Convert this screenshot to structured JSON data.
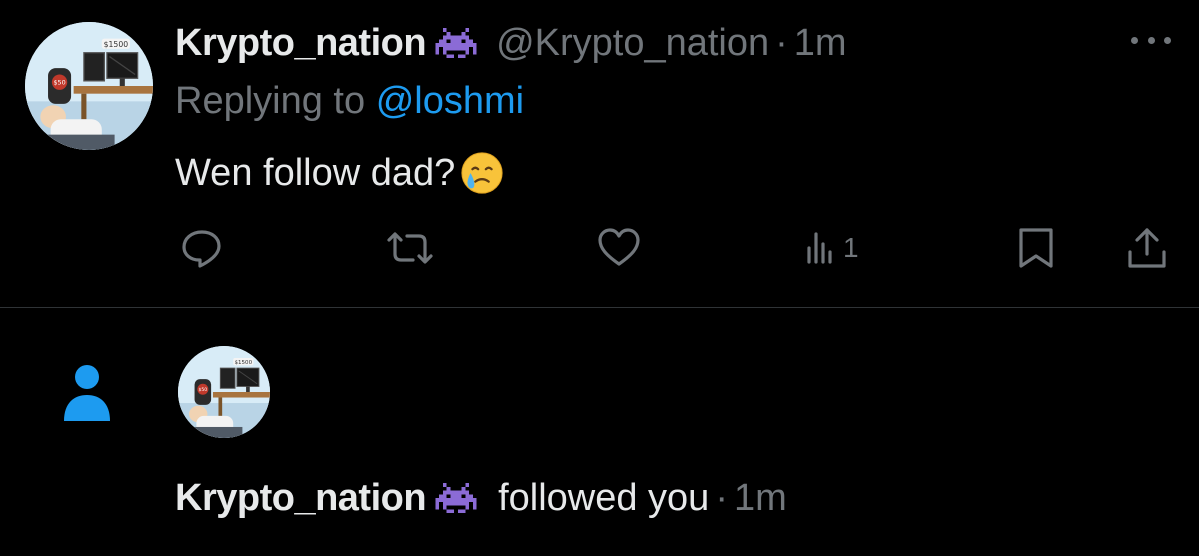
{
  "tweet": {
    "display_name": "Krypto_nation",
    "verified_badge_icon": "space-invader-icon",
    "handle": "@Krypto_nation",
    "separator": "·",
    "time": "1m",
    "replying_prefix": "Replying to",
    "replying_to": "@loshmi",
    "text": "Wen follow dad?",
    "emoji": "face-holding-back-tears-emoji",
    "actions": {
      "reply_icon": "reply-icon",
      "retweet_icon": "retweet-icon",
      "like_icon": "heart-icon",
      "views_icon": "views-chart-icon",
      "views_count": "1",
      "bookmark_icon": "bookmark-icon",
      "share_icon": "share-icon"
    }
  },
  "notification": {
    "type_icon": "person-icon",
    "display_name": "Krypto_nation",
    "badge_icon": "space-invader-icon",
    "action_text": "followed you",
    "separator": "·",
    "time": "1m"
  },
  "avatar_labels": {
    "price_top": "$1500",
    "price_chair": "$50"
  },
  "colors": {
    "background": "#000000",
    "primary_text": "#e7e9ea",
    "secondary_text": "#71767b",
    "link": "#1d9bf0",
    "divider": "#2f3336",
    "badge_purple": "#8b6bd6"
  }
}
